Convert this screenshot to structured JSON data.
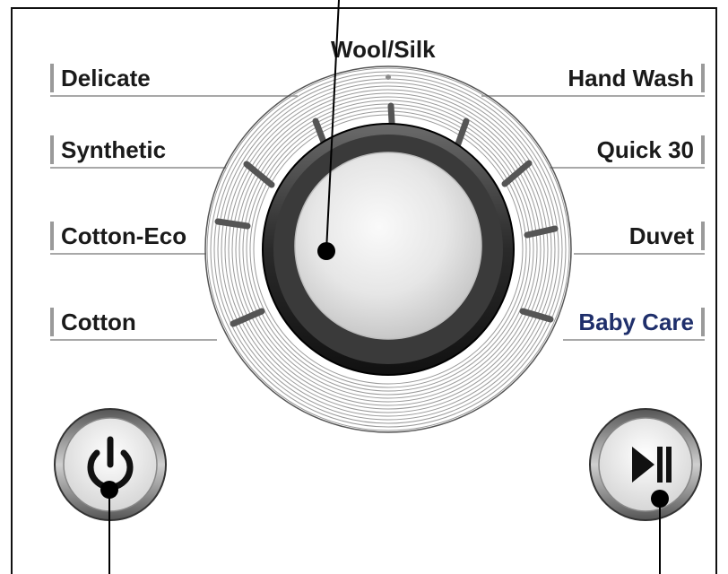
{
  "programs": {
    "left": [
      {
        "label": "Delicate"
      },
      {
        "label": "Synthetic"
      },
      {
        "label": "Cotton-Eco"
      },
      {
        "label": "Cotton"
      }
    ],
    "top": {
      "label": "Wool/Silk"
    },
    "right": [
      {
        "label": "Hand Wash"
      },
      {
        "label": "Quick 30"
      },
      {
        "label": "Duvet"
      },
      {
        "label": "Baby Care"
      }
    ]
  },
  "dial": {
    "icon": "program-selector-knob"
  },
  "buttons": {
    "power": {
      "icon": "power-icon"
    },
    "start_pause": {
      "icon": "play-pause-icon"
    }
  },
  "colors": {
    "accent_label": "#1f2f6b",
    "panel_outline": "#111111"
  }
}
